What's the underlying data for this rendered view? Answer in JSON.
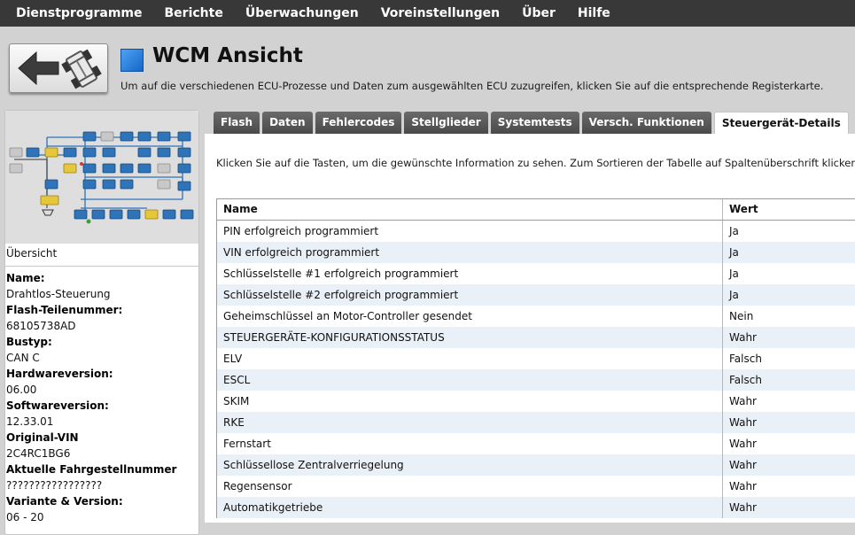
{
  "menu": {
    "items": [
      "Dienstprogramme",
      "Berichte",
      "Überwachungen",
      "Voreinstellungen",
      "Über",
      "Hilfe"
    ]
  },
  "header": {
    "title": "WCM Ansicht",
    "subtitle": "Um auf die verschiedenen ECU-Prozesse und Daten zum ausgewählten ECU zuzugreifen, klicken Sie auf die entsprechende Registerkarte.",
    "back_icon": "back-arrow-car-icon",
    "title_square_color": "#2272d6"
  },
  "sidebar": {
    "overview_label": "Übersicht",
    "fields": [
      {
        "label": "Name:",
        "value": "Drahtlos-Steuerung"
      },
      {
        "label": "Flash-Teilenummer:",
        "value": "68105738AD"
      },
      {
        "label": "Bustyp:",
        "value": "CAN C"
      },
      {
        "label": "Hardwareversion:",
        "value": "06.00"
      },
      {
        "label": "Softwareversion:",
        "value": "12.33.01"
      },
      {
        "label": "Original-VIN",
        "value": "2C4RC1BG6"
      },
      {
        "label": "Aktuelle Fahrgestellnummer",
        "value": "?????????????????"
      },
      {
        "label": "Variante & Version:",
        "value": "06 - 20"
      }
    ]
  },
  "tabs": [
    {
      "label": "Flash",
      "active": false
    },
    {
      "label": "Daten",
      "active": false
    },
    {
      "label": "Fehlercodes",
      "active": false
    },
    {
      "label": "Stellglieder",
      "active": false
    },
    {
      "label": "Systemtests",
      "active": false
    },
    {
      "label": "Versch. Funktionen",
      "active": false
    },
    {
      "label": "Steuergerät-Details",
      "active": true
    }
  ],
  "content": {
    "instruction": "Klicken Sie auf die Tasten, um die gewünschte Information zu sehen.  Zum Sortieren der Tabelle auf Spaltenüberschrift klicken.",
    "table": {
      "columns": [
        "Name",
        "Wert"
      ],
      "rows": [
        [
          "PIN erfolgreich programmiert",
          "Ja"
        ],
        [
          "VIN erfolgreich programmiert",
          "Ja"
        ],
        [
          "Schlüsselstelle #1 erfolgreich programmiert",
          "Ja"
        ],
        [
          "Schlüsselstelle #2 erfolgreich programmiert",
          "Ja"
        ],
        [
          "Geheimschlüssel an Motor-Controller gesendet",
          "Nein"
        ],
        [
          "STEUERGERÄTE-KONFIGURATIONSSTATUS",
          "Wahr"
        ],
        [
          "ELV",
          "Falsch"
        ],
        [
          "ESCL",
          "Falsch"
        ],
        [
          "SKIM",
          "Wahr"
        ],
        [
          "RKE",
          "Wahr"
        ],
        [
          "Fernstart",
          "Wahr"
        ],
        [
          "Schlüssellose Zentralverriegelung",
          "Wahr"
        ],
        [
          "Regensensor",
          "Wahr"
        ],
        [
          "Automatikgetriebe",
          "Wahr"
        ]
      ]
    }
  },
  "colors": {
    "menubar": "#383838",
    "tab": "#555555",
    "row_alt": "#e9f0f8",
    "ecu_blue": "#2f73b8",
    "ecu_yellow": "#e6c63a",
    "ecu_gray": "#c8c8c8"
  }
}
